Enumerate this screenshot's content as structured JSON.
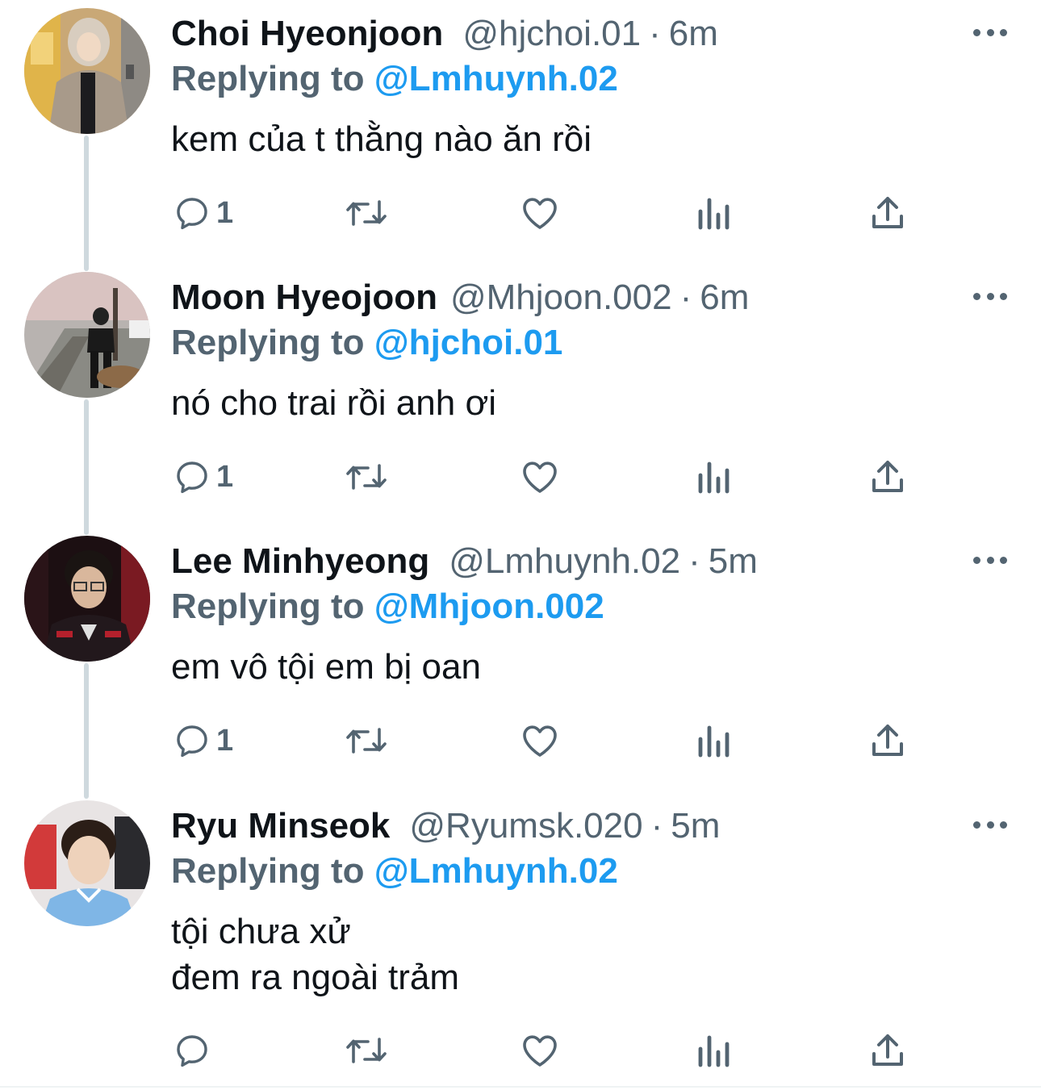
{
  "tweets": [
    {
      "name": "Choi Hyeonjoon",
      "handle": "@hjchoi.01",
      "separator": "·",
      "time": "6m",
      "replying_prefix": "Replying to",
      "replying_to": "@Lmhuynh.02",
      "text": "kem của t thằng nào ăn rồi",
      "reply_count": "1"
    },
    {
      "name": "Moon Hyeojoon",
      "handle": "@Mhjoon.002",
      "separator": "·",
      "time": "6m",
      "replying_prefix": "Replying to",
      "replying_to": "@hjchoi.01",
      "text": "nó cho trai rồi anh ơi",
      "reply_count": "1"
    },
    {
      "name": "Lee Minhyeong",
      "handle": "@Lmhuynh.02",
      "separator": "·",
      "time": "5m",
      "replying_prefix": "Replying to",
      "replying_to": "@Mhjoon.002",
      "text": "em vô tội em bị oan",
      "reply_count": "1"
    },
    {
      "name": "Ryu Minseok",
      "handle": "@Ryumsk.020",
      "separator": "·",
      "time": "5m",
      "replying_prefix": "Replying to",
      "replying_to": "@Lmhuynh.02",
      "text": "tội chưa xử\nđem ra ngoài trảm",
      "reply_count": ""
    }
  ],
  "icons": {
    "reply": "reply-icon",
    "retweet": "retweet-icon",
    "like": "heart-icon",
    "views": "views-icon",
    "share": "share-icon",
    "more": "more-icon"
  },
  "colors": {
    "accent": "#1d9bf0",
    "secondary_text": "#536471",
    "primary_text": "#0f1419",
    "thread_line": "#cfd9de"
  }
}
